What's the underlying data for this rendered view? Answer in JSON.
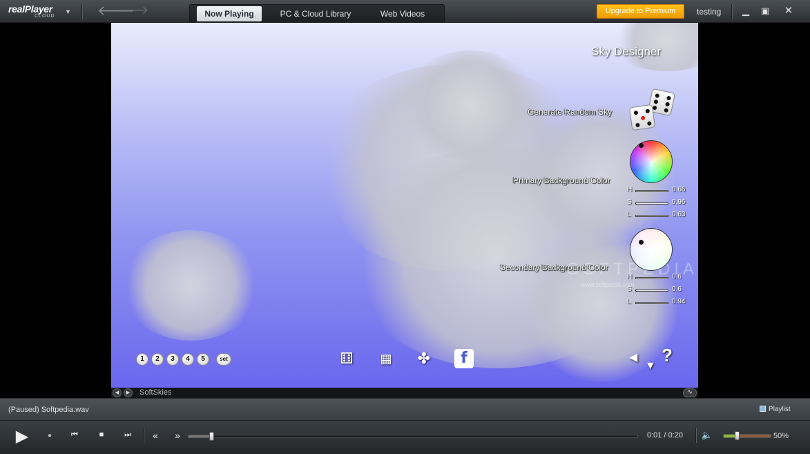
{
  "app": {
    "brand": "realPlayer",
    "brand_sub": "CLOUD",
    "user": "testing"
  },
  "tabs": [
    {
      "label": "Now Playing",
      "active": true
    },
    {
      "label": "PC & Cloud Library",
      "active": false
    },
    {
      "label": "Web Videos",
      "active": false
    }
  ],
  "upgrade_label": "Upgrade to Premium",
  "sky": {
    "title": "Sky Designer",
    "random_label": "Generate Random Sky",
    "primary_label": "Primary Background Color",
    "secondary_label": "Secondary Background Color",
    "primary": {
      "h": "0.66",
      "s": "0.96",
      "l": "0.63"
    },
    "secondary": {
      "h": "0.6",
      "s": "0.6",
      "l": "0.94"
    },
    "hsl_keys": {
      "h": "H",
      "s": "S",
      "l": "L"
    },
    "presets": [
      "1",
      "2",
      "3",
      "4",
      "5"
    ],
    "preset_set": "set",
    "help": "?",
    "watermark": "SOFTPEDIA",
    "watermark_url": "www.softpedia.com",
    "colors": {
      "sky_top": "#e9ecfb",
      "sky_bottom": "#6a67ee",
      "facebook": "#4a5bd0"
    }
  },
  "visualizer": {
    "name": "SoftSkies"
  },
  "status": {
    "text": "(Paused) Softpedia.wav",
    "playlist": "Playlist"
  },
  "player": {
    "time": "0:01 / 0:20",
    "volume": "50%",
    "progress": 0.05,
    "volume_level": 0.28
  }
}
